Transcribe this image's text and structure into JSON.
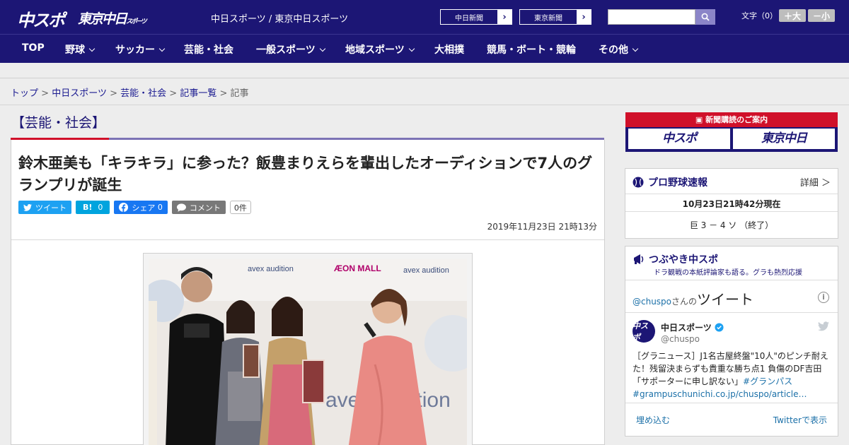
{
  "header": {
    "logo_main": "中スポ",
    "logo_tokyo": "東京中日",
    "logo_tokyo_small": "スポーツ",
    "site_links": "中日スポーツ / 東京中日スポーツ",
    "btn_chunichi": "中日新聞",
    "btn_tokyo": "東京新聞",
    "search_placeholder": "",
    "font_size_label": "文字（0）",
    "font_bigger": "＋大",
    "font_smaller": "－小"
  },
  "nav": {
    "items": [
      {
        "label": "TOP"
      },
      {
        "label": "野球"
      },
      {
        "label": "サッカー"
      },
      {
        "label": "芸能・社会"
      },
      {
        "label": "一般スポーツ"
      },
      {
        "label": "地域スポーツ"
      },
      {
        "label": "大相撲"
      },
      {
        "label": "競馬・ボート・競輪"
      },
      {
        "label": "その他"
      }
    ]
  },
  "breadcrumb": {
    "items": [
      "トップ",
      "中日スポーツ",
      "芸能・社会",
      "記事一覧"
    ],
    "current": "記事",
    "separator": ">"
  },
  "article": {
    "category": "【芸能・社会】",
    "headline": "鈴木亜美も「キラキラ」に参った？飯豊まりえらを輩出したオーディションで7人のグランプリが誕生",
    "share": {
      "tweet": "ツイート",
      "hatena_icon": "B!",
      "hatena_count": "0",
      "facebook": "シェア",
      "facebook_count": "0",
      "comment": "コメント",
      "comment_count": "0件"
    },
    "published": "2019年11月23日 21時13分",
    "photo_signs": {
      "sign_1": "avex audition",
      "sign_2": "ÆON MALL",
      "sign_3": "avex audition",
      "sign_4": "avex audition"
    }
  },
  "sidebar": {
    "subscribe": {
      "title": "新聞購読のご案内",
      "left": "中スポ",
      "right": "東京中日"
    },
    "baseball": {
      "title": "プロ野球速報",
      "detail": "詳細 ＞",
      "updated": "10月23日21時42分現在",
      "score": "巨 3 － 4 ソ （終了）"
    },
    "tweets": {
      "title": "つぶやき中スポ",
      "subtitle": "ドラ観戦の本紙評論家も語る。グラも熱烈応援",
      "handle_prefix": "@chuspo",
      "handle_suffix": "さんの",
      "timeline_label": "ツイート",
      "account_name": "中日スポーツ",
      "account_handle": "@chuspo",
      "tweet_text": "［グラニュース］J1名古屋終盤\"10人\"のピンチ耐えた！残留決まらずも貴重な勝ち点1 負傷のDF吉田「サポーターに申し訳ない」",
      "tweet_tag": "#グランパス",
      "tweet_link": "#grampuschunichi.co.jp/chuspo/article…",
      "embed": "埋め込む",
      "view_on_twitter": "Twitterで表示"
    }
  },
  "colors": {
    "brand_navy": "#1c1675",
    "accent_red": "#d0102a",
    "twitter_blue": "#1da1f2",
    "hatena_blue": "#00a4de",
    "facebook_blue": "#1877f2"
  }
}
